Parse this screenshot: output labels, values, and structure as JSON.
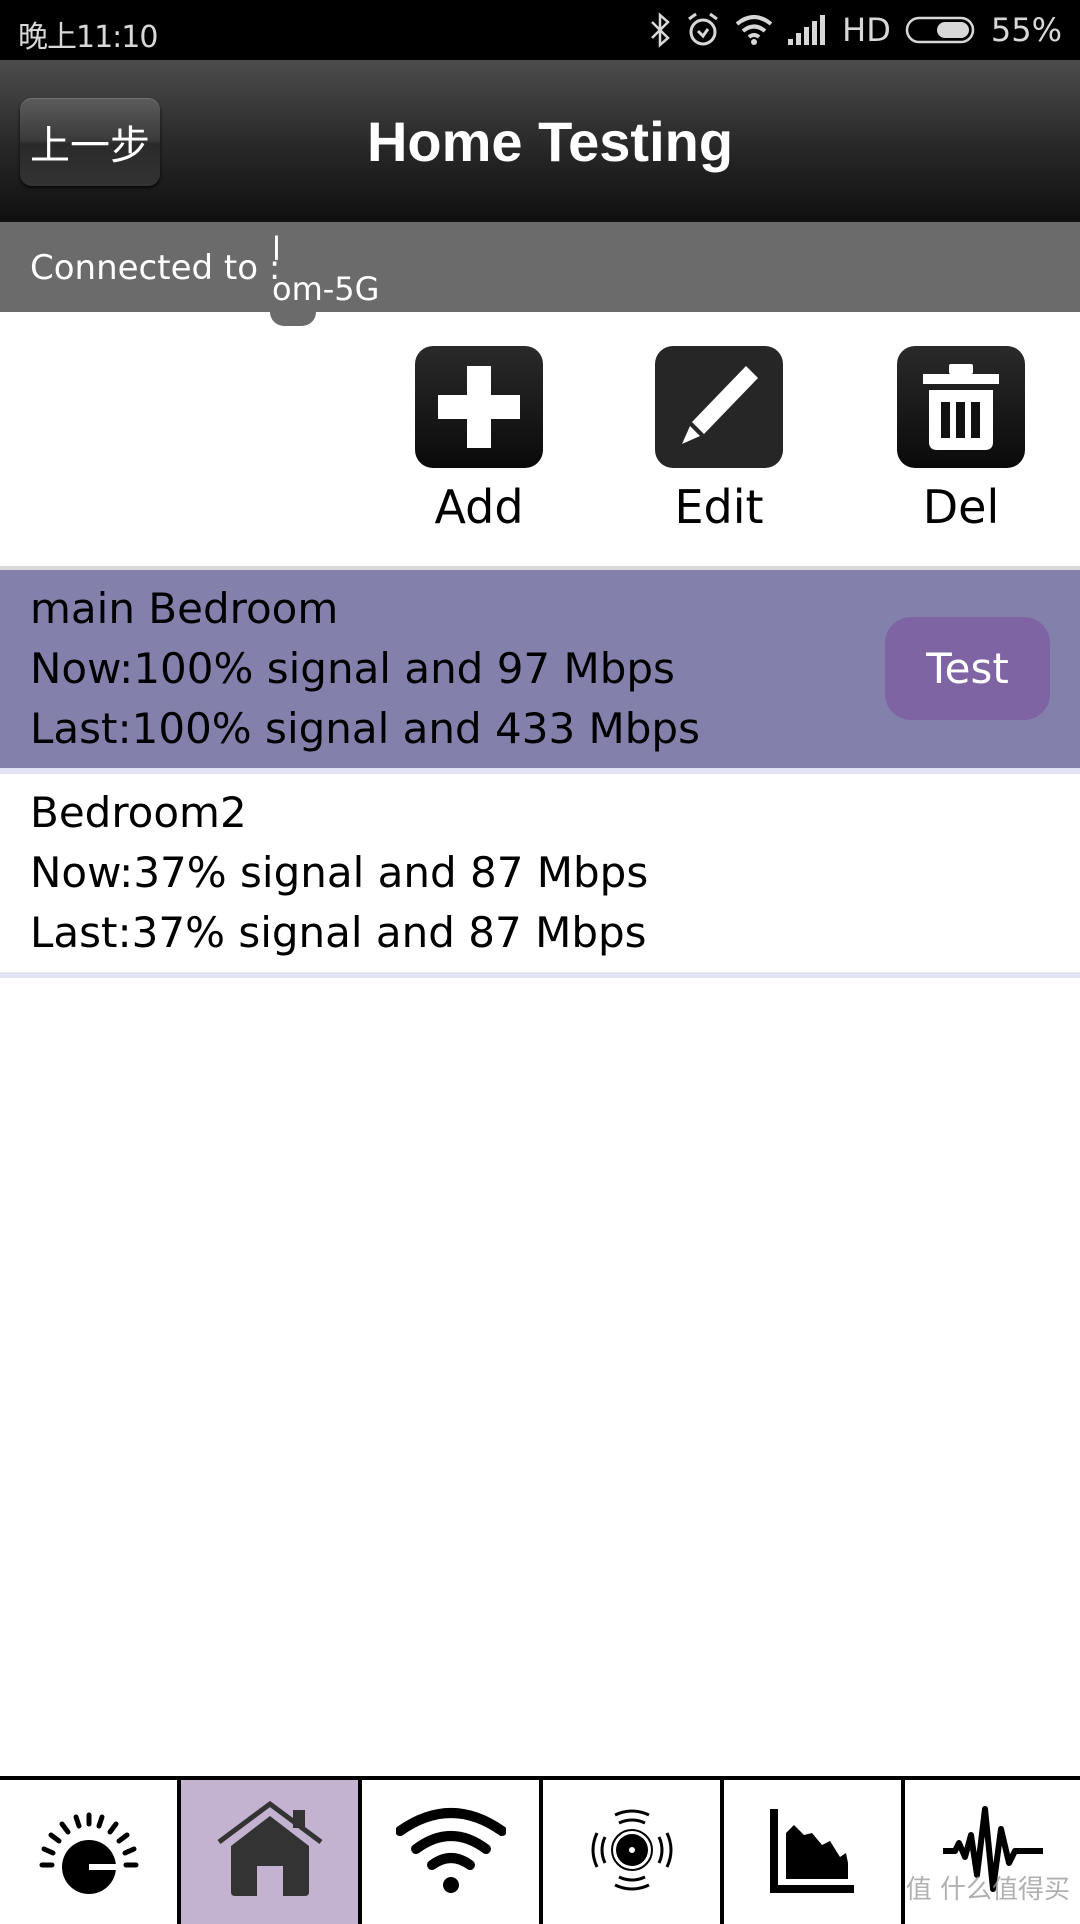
{
  "status_bar": {
    "time": "晚上11:10",
    "icons": [
      "bluetooth-icon",
      "alarm-icon",
      "wifi-icon",
      "signal-icon"
    ],
    "network_type": "HD",
    "battery_percent": "55%",
    "battery_level": 0.55
  },
  "header": {
    "back_label": "上一步",
    "title": "Home Testing"
  },
  "connection": {
    "label": "Connected to :",
    "ssid_line1": "l",
    "ssid_line2": "om-5G"
  },
  "toolbar": {
    "add_label": "Add",
    "edit_label": "Edit",
    "del_label": "Del"
  },
  "locations": [
    {
      "name": "main Bedroom",
      "now": "Now:100% signal and 97 Mbps",
      "last": "Last:100% signal and 433 Mbps",
      "selected": true,
      "test_label": "Test"
    },
    {
      "name": "Bedroom2",
      "now": "Now:37% signal and 87 Mbps",
      "last": "Last:37% signal and 87 Mbps",
      "selected": false
    }
  ],
  "bottom_nav": {
    "tabs": [
      {
        "icon": "dial-gauge-icon",
        "active": false
      },
      {
        "icon": "home-icon",
        "active": true
      },
      {
        "icon": "wifi-icon",
        "active": false
      },
      {
        "icon": "signal-radiate-icon",
        "active": false
      },
      {
        "icon": "area-chart-icon",
        "active": false
      },
      {
        "icon": "waveform-icon",
        "active": false
      }
    ]
  },
  "watermark": "值 什么值得买",
  "colors": {
    "selected_row": "#8381ab",
    "test_button": "#7f64a4",
    "active_tab": "#c3b3d1",
    "separator": "#e4e4f7",
    "connection_bar": "#6b6b6b"
  }
}
